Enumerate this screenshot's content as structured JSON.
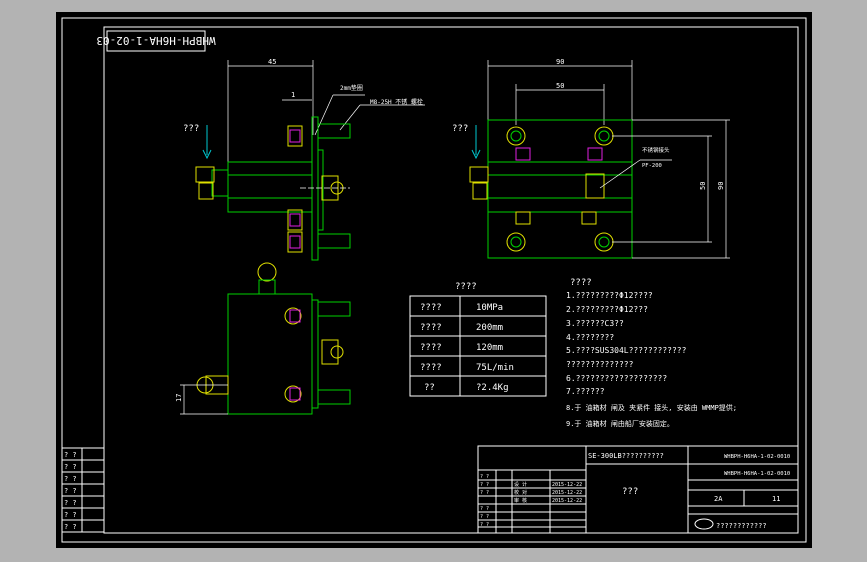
{
  "drawing_no_rotated": "WHBPH-H6HA-1-02-03",
  "annotations": {
    "left_arrow_label": "???",
    "right_arrow_label": "???",
    "dim_45": "45",
    "dim_1": "1",
    "note_top": "2mm垫圈",
    "note_bolt": "M8-25H 不锈 螺栓",
    "dim_top_outer": "90",
    "dim_top_inner": "50",
    "dim_right_a": "90",
    "dim_right_b": "50",
    "side_note": "不锈钢接头\nPF-200",
    "dim_17": "17"
  },
  "param_table": {
    "title": "????",
    "rows": [
      {
        "name": "????",
        "value": "10MPa"
      },
      {
        "name": "????",
        "value": "200mm"
      },
      {
        "name": "????",
        "value": "120mm"
      },
      {
        "name": "????",
        "value": "75L/min"
      },
      {
        "name": "??",
        "value": "?2.4Kg"
      }
    ]
  },
  "requirements": {
    "title": "????",
    "lines": [
      "1.?????????Φ12????",
      "2.?????????Φ12???",
      "3.??????C3??",
      "4.????????",
      "5.????SUS304L????????????",
      "  ??????????????",
      "6.???????????????????",
      "7.??????",
      "8.于 油箱材 闸及 夹紧件 接头, 安装由 WMMP提供;",
      "9.于 油箱材 闸由船厂安装固定。"
    ]
  },
  "left_table": {
    "rows": [
      "? ?",
      "? ?",
      "? ?",
      "? ?",
      "? ?",
      "? ?",
      "? ?"
    ]
  },
  "title_block": {
    "product": "SE-300LB??????????",
    "drawing_no": "WHBPH-H6HA-1-02-0010",
    "drawing_no2": "WHBPH-H6HA-1-02-0010",
    "name_box": "???",
    "scale": "2A",
    "sheet": "11",
    "company": "????????????",
    "dates": [
      "2015-12-22",
      "2015-12-22",
      "2015-12-22"
    ],
    "roles": [
      "设 计",
      "校 对",
      "审 核"
    ],
    "small_marks": [
      "? ?",
      "? ?",
      "? ?",
      "? ?",
      "? ?",
      "? ?"
    ]
  }
}
